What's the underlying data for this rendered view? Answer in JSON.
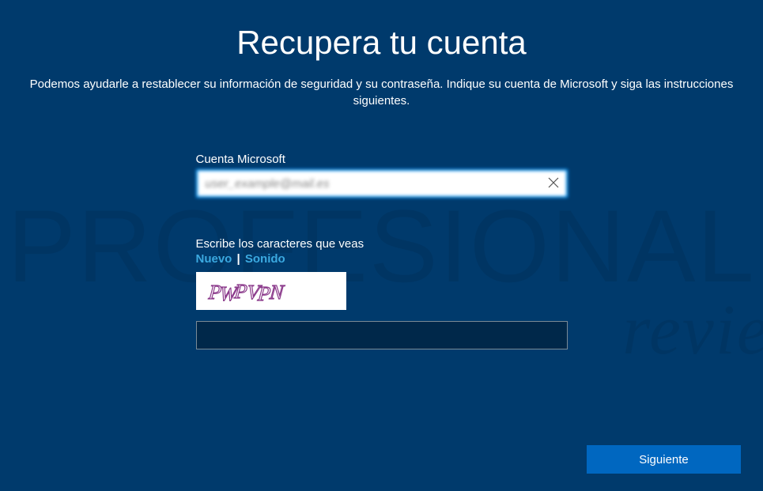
{
  "header": {
    "title": "Recupera tu cuenta",
    "subtitle": "Podemos ayudarle a restablecer su información de seguridad y su contraseña. Indique su cuenta de Microsoft y siga las instrucciones siguientes."
  },
  "form": {
    "account_label": "Cuenta Microsoft",
    "account_value": "user_example@mail.es",
    "captcha_label": "Escribe los caracteres que veas",
    "captcha_new_link": "Nuevo",
    "captcha_divider": "|",
    "captcha_sound_link": "Sonido",
    "captcha_text": "PWPVPN",
    "captcha_input_value": ""
  },
  "actions": {
    "next_label": "Siguiente"
  },
  "watermark": {
    "line1": "PROFESIONAL",
    "line2": "review"
  }
}
